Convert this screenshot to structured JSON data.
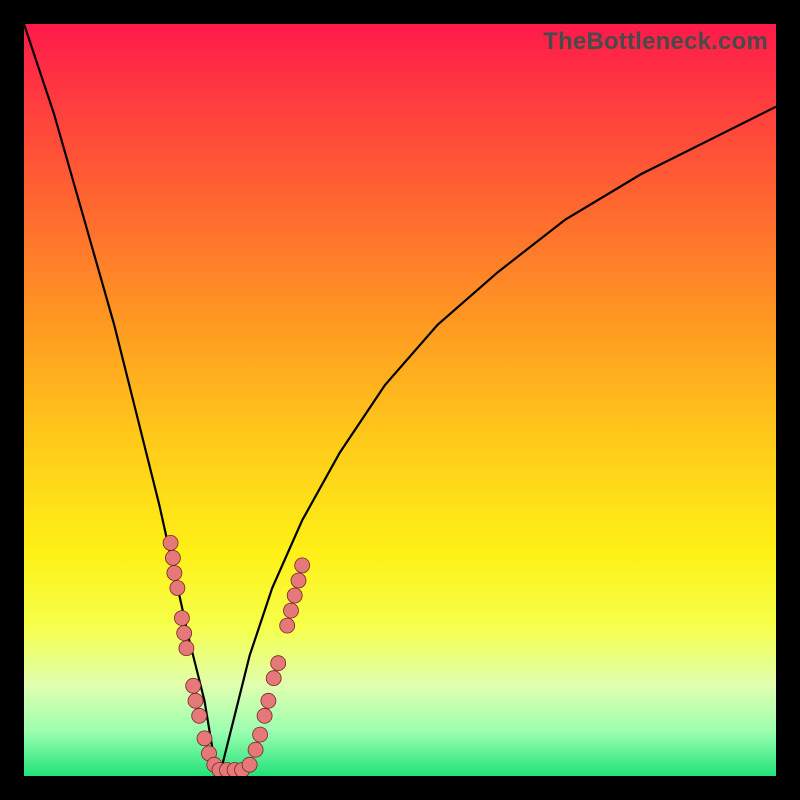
{
  "watermark": "TheBottleneck.com",
  "colors": {
    "frame": "#000000",
    "bead_fill": "#e57878",
    "bead_stroke": "#7a2525",
    "curve": "#000000"
  },
  "chart_data": {
    "type": "line",
    "title": "",
    "xlabel": "",
    "ylabel": "",
    "xlim": [
      0,
      100
    ],
    "ylim": [
      0,
      100
    ],
    "note": "Two monotone curves descending into a V-shaped valley near x≈26 against a vertical red→green gradient. Values are visual estimates in percent of plot area (origin bottom-left).",
    "series": [
      {
        "name": "left-curve",
        "x": [
          0,
          4,
          8,
          12,
          15,
          18,
          20,
          22,
          24,
          25,
          26
        ],
        "y": [
          100,
          88,
          74,
          60,
          48,
          36,
          27,
          18,
          10,
          4,
          0
        ]
      },
      {
        "name": "right-curve",
        "x": [
          26,
          28,
          30,
          33,
          37,
          42,
          48,
          55,
          63,
          72,
          82,
          92,
          100
        ],
        "y": [
          0,
          8,
          16,
          25,
          34,
          43,
          52,
          60,
          67,
          74,
          80,
          85,
          89
        ]
      }
    ],
    "beads": {
      "note": "Clusters of small pink beads along lower portion of both curves and across valley floor. Coordinates in percent of plot area (origin bottom-left).",
      "points": [
        [
          19.5,
          31
        ],
        [
          19.8,
          29
        ],
        [
          20.0,
          27
        ],
        [
          20.4,
          25
        ],
        [
          21.0,
          21
        ],
        [
          21.3,
          19
        ],
        [
          21.6,
          17
        ],
        [
          22.5,
          12
        ],
        [
          22.8,
          10
        ],
        [
          23.3,
          8
        ],
        [
          24.0,
          5
        ],
        [
          24.6,
          3
        ],
        [
          25.3,
          1.5
        ],
        [
          26.0,
          0.8
        ],
        [
          27.0,
          0.8
        ],
        [
          28.0,
          0.8
        ],
        [
          29.0,
          0.8
        ],
        [
          30.0,
          1.5
        ],
        [
          30.8,
          3.5
        ],
        [
          31.4,
          5.5
        ],
        [
          32.0,
          8
        ],
        [
          32.5,
          10
        ],
        [
          33.2,
          13
        ],
        [
          33.8,
          15
        ],
        [
          35.0,
          20
        ],
        [
          35.5,
          22
        ],
        [
          36.0,
          24
        ],
        [
          36.5,
          26
        ],
        [
          37.0,
          28
        ]
      ],
      "radius_pct": 1.0
    },
    "gradient_stops": [
      {
        "pct": 0,
        "color": "#ff1a4a"
      },
      {
        "pct": 10,
        "color": "#ff3b3f"
      },
      {
        "pct": 25,
        "color": "#ff6a2f"
      },
      {
        "pct": 40,
        "color": "#ff9a22"
      },
      {
        "pct": 55,
        "color": "#ffc91a"
      },
      {
        "pct": 70,
        "color": "#fff016"
      },
      {
        "pct": 80,
        "color": "#f6ff4a"
      },
      {
        "pct": 88,
        "color": "#e0ffb0"
      },
      {
        "pct": 94,
        "color": "#9cffb0"
      },
      {
        "pct": 100,
        "color": "#22e27a"
      }
    ]
  }
}
